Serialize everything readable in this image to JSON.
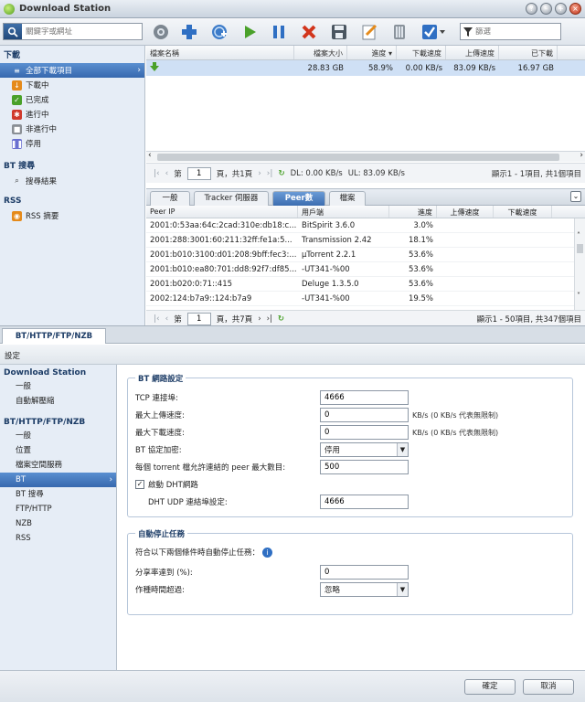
{
  "app": {
    "title": "Download Station"
  },
  "toolbar": {
    "search_placeholder": "關鍵字或網址",
    "filter_placeholder": "篩選"
  },
  "sidebar": {
    "download_head": "下載",
    "items": [
      {
        "label": "全部下載項目",
        "icon": "list-icon",
        "color": "#ffffff"
      },
      {
        "label": "下載中",
        "icon": "download-icon",
        "color": "#e58a1a"
      },
      {
        "label": "已完成",
        "icon": "check-icon",
        "color": "#4aa12a"
      },
      {
        "label": "進行中",
        "icon": "active-icon",
        "color": "#d0392b"
      },
      {
        "label": "非進行中",
        "icon": "inactive-icon",
        "color": "#8a8f95"
      },
      {
        "label": "停用",
        "icon": "pause-icon",
        "color": "#6a6fd0"
      }
    ],
    "bt_head": "BT 搜尋",
    "bt_item": "搜尋結果",
    "rss_head": "RSS",
    "rss_item": "RSS 摘要"
  },
  "grid": {
    "headers": [
      "檔案名稱",
      "檔案大小",
      "進度 ▾",
      "下載速度",
      "上傳速度",
      "已下載"
    ],
    "rows": [
      {
        "name": "",
        "size": "28.83 GB",
        "progress": "58.9%",
        "dl": "0.00 KB/s",
        "ul": "83.09 KB/s",
        "downloaded": "16.97 GB"
      }
    ]
  },
  "pager1": {
    "page_prefix": "第",
    "page": "1",
    "page_suffix": "頁，共1頁",
    "dl": "DL: 0.00 KB/s",
    "ul": "UL: 83.09 KB/s",
    "summary": "顯示1 - 1項目, 共1個項目"
  },
  "detail_tabs": [
    "一般",
    "Tracker 伺服器",
    "Peer數",
    "檔案"
  ],
  "peer_headers": [
    "Peer IP",
    "用戶端",
    "進度",
    "上傳速度",
    "下載速度"
  ],
  "peers": [
    {
      "ip": "2001:0:53aa:64c:2cad:310e:db18:c...",
      "client": "BitSpirit 3.6.0",
      "progress": "3.0%"
    },
    {
      "ip": "2001:288:3001:60:211:32ff:fe1a:5...",
      "client": "Transmission 2.42",
      "progress": "18.1%"
    },
    {
      "ip": "2001:b010:3100:d01:208:9bff:fec3:...",
      "client": "µTorrent 2.2.1",
      "progress": "53.6%"
    },
    {
      "ip": "2001:b010:ea80:701:dd8:92f7:df85...",
      "client": "-UT341-%00",
      "progress": "53.6%"
    },
    {
      "ip": "2001:b020:0:71::415",
      "client": "Deluge 1.3.5.0",
      "progress": "53.6%"
    },
    {
      "ip": "2002:124:b7a9::124:b7a9",
      "client": "-UT341-%00",
      "progress": "19.5%"
    }
  ],
  "pager2": {
    "page_prefix": "第",
    "page": "1",
    "page_suffix": "頁，共7頁",
    "summary": "顯示1 - 50項目, 共347個項目"
  },
  "bottom_tab": "BT/HTTP/FTP/NZB",
  "settings": {
    "title": "設定",
    "side": {
      "ds_head": "Download Station",
      "ds_items": [
        "一般",
        "自動解壓縮"
      ],
      "bt_head": "BT/HTTP/FTP/NZB",
      "bt_items": [
        "一般",
        "位置",
        "檔案空間服務",
        "BT",
        "BT 搜尋",
        "FTP/HTTP",
        "NZB",
        "RSS"
      ]
    },
    "bt_group": {
      "legend": "BT 網路設定",
      "tcp_label": "TCP 連接埠:",
      "tcp_value": "4666",
      "up_label": "最大上傳速度:",
      "up_value": "0",
      "up_hint": "KB/s (0 KB/s 代表無限制)",
      "down_label": "最大下載速度:",
      "down_value": "0",
      "down_hint": "KB/s (0 KB/s 代表無限制)",
      "enc_label": "BT 協定加密:",
      "enc_value": "停用",
      "peer_label": "每個 torrent 檔允許連結的 peer 最大數目:",
      "peer_value": "500",
      "dht_label": "啟動 DHT網路",
      "dht_port_label": "DHT UDP 連結埠設定:",
      "dht_port_value": "4666"
    },
    "stop_group": {
      "legend": "自動停止任務",
      "desc": "符合以下兩個條件時自動停止任務：",
      "ratio_label": "分享率達到 (%):",
      "ratio_value": "0",
      "time_label": "作種時間超過:",
      "time_value": "忽略"
    },
    "ok": "確定",
    "cancel": "取消"
  }
}
